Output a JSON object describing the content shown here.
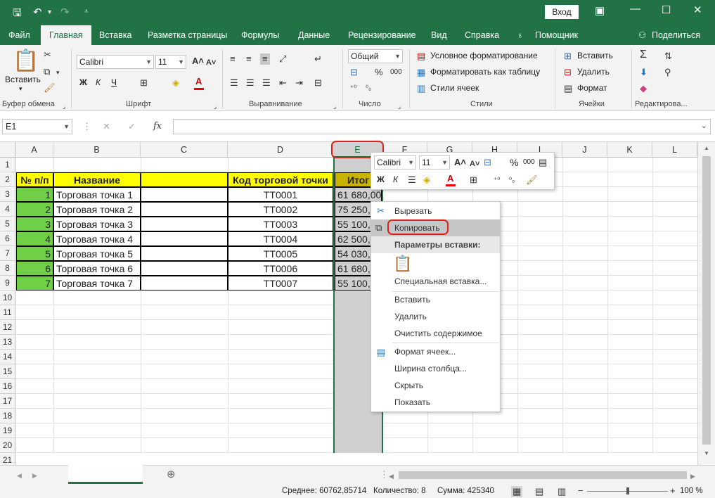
{
  "title_bar": {
    "login_label": "Вход",
    "min_icon": "minimize-icon",
    "restore_icon": "restore-icon",
    "close_icon": "close-icon"
  },
  "tabs": [
    {
      "label": "Файл"
    },
    {
      "label": "Главная"
    },
    {
      "label": "Вставка"
    },
    {
      "label": "Разметка страницы"
    },
    {
      "label": "Формулы"
    },
    {
      "label": "Данные"
    },
    {
      "label": "Рецензирование"
    },
    {
      "label": "Вид"
    },
    {
      "label": "Справка"
    },
    {
      "label": "Помощник"
    }
  ],
  "share_label": "Поделиться",
  "ribbon": {
    "paste_label": "Вставить",
    "font_name": "Calibri",
    "font_size": "11",
    "bold": "Ж",
    "italic": "К",
    "underline": "Ч",
    "number_format": "Общий",
    "cond_format": "Условное форматирование",
    "format_table": "Форматировать как таблицу",
    "cell_styles": "Стили ячеек",
    "insert": "Вставить",
    "delete": "Удалить",
    "format": "Формат",
    "groups": {
      "clipboard": "Буфер обмена",
      "font": "Шрифт",
      "alignment": "Выравнивание",
      "number": "Число",
      "styles": "Стили",
      "cells": "Ячейки",
      "editing": "Редактирова..."
    }
  },
  "formula_bar": {
    "name_box": "E1",
    "fx": "fx",
    "formula": ""
  },
  "columns": [
    "A",
    "B",
    "C",
    "D",
    "E",
    "F",
    "G",
    "H",
    "I",
    "J",
    "K",
    "L"
  ],
  "rows": [
    "1",
    "2",
    "3",
    "4",
    "5",
    "6",
    "7",
    "8",
    "9",
    "10",
    "11",
    "12",
    "13",
    "14",
    "15",
    "16",
    "17",
    "18",
    "19",
    "20",
    "21"
  ],
  "table": {
    "headers": {
      "a": "№ п/п",
      "b": "Название",
      "d": "Код торговой точки",
      "e": "Итог"
    },
    "data": [
      {
        "n": "1",
        "name": "Торговая точка 1",
        "code": "ТТ0001",
        "total": "61 680,00"
      },
      {
        "n": "2",
        "name": "Торговая точка 2",
        "code": "ТТ0002",
        "total": "75 250,"
      },
      {
        "n": "3",
        "name": "Торговая точка 3",
        "code": "ТТ0003",
        "total": "55 100,"
      },
      {
        "n": "4",
        "name": "Торговая точка 4",
        "code": "ТТ0004",
        "total": "62 500,"
      },
      {
        "n": "5",
        "name": "Торговая точка 5",
        "code": "ТТ0005",
        "total": "54 030,"
      },
      {
        "n": "6",
        "name": "Торговая точка 6",
        "code": "ТТ0006",
        "total": "61 680,"
      },
      {
        "n": "7",
        "name": "Торговая точка 7",
        "code": "ТТ0007",
        "total": "55 100,"
      }
    ]
  },
  "mini_toolbar": {
    "font": "Calibri",
    "size": "11",
    "bold": "Ж",
    "italic": "К",
    "percent": "%",
    "thousands": "000"
  },
  "context_menu": {
    "cut": "Вырезать",
    "copy": "Копировать",
    "paste_options": "Параметры вставки:",
    "paste_special": "Специальная вставка...",
    "insert": "Вставить",
    "delete": "Удалить",
    "clear": "Очистить содержимое",
    "format_cells": "Формат ячеек...",
    "col_width": "Ширина столбца...",
    "hide": "Скрыть",
    "show": "Показать"
  },
  "status": {
    "average": "Среднее: 60762,85714",
    "count": "Количество: 8",
    "sum": "Сумма: 425340",
    "zoom": "100 %"
  },
  "colors": {
    "brand": "#217346",
    "header_fill": "#ffff00",
    "number_fill": "#6fcf47",
    "highlight": "#e0201b"
  }
}
